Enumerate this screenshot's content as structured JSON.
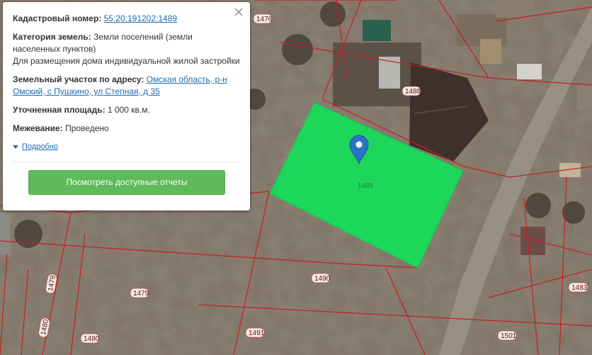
{
  "map": {
    "parcels": {
      "selected": "1489",
      "others": [
        "1476",
        "1488",
        "1490",
        "1479",
        "1491",
        "1480",
        "1501",
        "1483"
      ]
    },
    "colors": {
      "selected_fill": "#1dd75a",
      "boundary": "#c81e1e",
      "marker": "#2a72c4"
    }
  },
  "popup": {
    "cadastral_label": "Кадастровый номер:",
    "cadastral_value": "55:20:191202:1489",
    "category_label": "Категория земель:",
    "category_value": "Земли поселений (земли населенных пунктов)",
    "usage_value": "Для размещения дома индивидуальной жилой застройки",
    "address_label": "Земельный участок по адресу:",
    "address_value": "Омская область, р-н Омский, с Пушкино, ул Степная, д 35",
    "area_label": "Уточненная площадь:",
    "area_value": "1 000 кв.м.",
    "survey_label": "Межевание:",
    "survey_value": "Проведено",
    "details_label": "Подробно",
    "reports_button": "Посмотреть доступные отчеты"
  }
}
